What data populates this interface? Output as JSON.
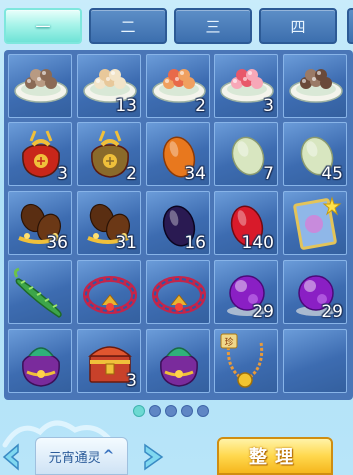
{
  "tabs": [
    {
      "label": "一",
      "active": true
    },
    {
      "label": "二",
      "active": false
    },
    {
      "label": "三",
      "active": false
    },
    {
      "label": "四",
      "active": false
    }
  ],
  "items": [
    {
      "icon": "tangyuan-plate-brown-icon",
      "qty": ""
    },
    {
      "icon": "tangyuan-plate-white-icon",
      "qty": "13"
    },
    {
      "icon": "tangyuan-plate-orange-icon",
      "qty": "2"
    },
    {
      "icon": "tangyuan-plate-pink-icon",
      "qty": "3"
    },
    {
      "icon": "tangyuan-plate-dark-icon",
      "qty": ""
    },
    {
      "icon": "red-lucky-bag-icon",
      "qty": "3"
    },
    {
      "icon": "gold-lucky-bag-icon",
      "qty": "2"
    },
    {
      "icon": "orange-gem-icon",
      "qty": "34"
    },
    {
      "icon": "pale-green-stone-icon",
      "qty": "7"
    },
    {
      "icon": "pale-green-stone-icon",
      "qty": "45"
    },
    {
      "icon": "gold-brown-beans-icon",
      "qty": "36"
    },
    {
      "icon": "gold-brown-beans-icon",
      "qty": "31"
    },
    {
      "icon": "dark-purple-gem-icon",
      "qty": "16"
    },
    {
      "icon": "red-gem-icon",
      "qty": "140"
    },
    {
      "icon": "star-card-icon",
      "qty": ""
    },
    {
      "icon": "green-cucumber-icon",
      "qty": ""
    },
    {
      "icon": "ornate-headband-icon",
      "qty": ""
    },
    {
      "icon": "ornate-headband-icon",
      "qty": ""
    },
    {
      "icon": "purple-orb-icon",
      "qty": "29"
    },
    {
      "icon": "purple-orb-icon",
      "qty": "29"
    },
    {
      "icon": "purple-pouch-icon",
      "qty": ""
    },
    {
      "icon": "treasure-chest-icon",
      "qty": "3"
    },
    {
      "icon": "purple-pouch-icon",
      "qty": ""
    },
    {
      "icon": "treasure-necklace-icon",
      "qty": ""
    },
    {
      "icon": "",
      "qty": ""
    }
  ],
  "pager": {
    "pages": 5,
    "current": 1
  },
  "bottom": {
    "mode_label": "元宵通灵",
    "sort_label": "整理"
  },
  "colors": {
    "active_tab": "#7ee7dd",
    "tab": "#3c6fae",
    "cell": "#3d6cb1",
    "sort_button": "#ffd84d"
  }
}
